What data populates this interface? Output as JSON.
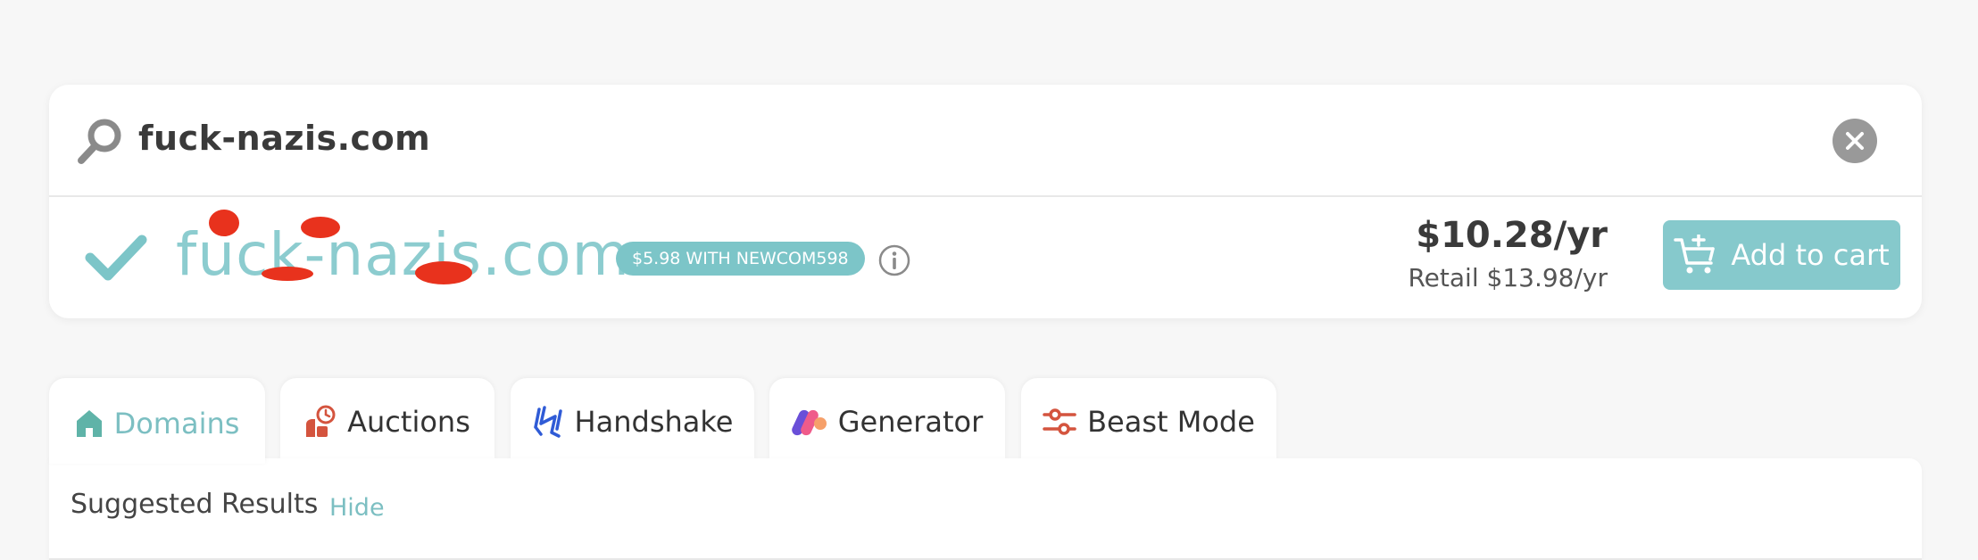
{
  "search": {
    "query": "fuck-nazis.com",
    "icon": "search-icon",
    "clear_icon": "close-icon"
  },
  "result": {
    "status_icon": "checkmark-icon",
    "domain": "fuck-nazis.com",
    "promo": "$5.98 WITH NEWCOM598",
    "info_icon": "info-icon",
    "price": "$10.28/yr",
    "retail": "Retail $13.98/yr",
    "add_to_cart": "Add to cart",
    "cart_icon": "cart-icon"
  },
  "tabs": [
    {
      "label": "Domains",
      "icon": "home-icon",
      "active": true
    },
    {
      "label": "Auctions",
      "icon": "auction-icon",
      "active": false
    },
    {
      "label": "Handshake",
      "icon": "handshake-icon",
      "active": false
    },
    {
      "label": "Generator",
      "icon": "generator-icon",
      "active": false
    },
    {
      "label": "Beast Mode",
      "icon": "sliders-icon",
      "active": false
    }
  ],
  "suggested": {
    "title": "Suggested Results",
    "hide": "Hide"
  },
  "colors": {
    "accent": "#86c9cc",
    "redaction": "#e8321d"
  }
}
